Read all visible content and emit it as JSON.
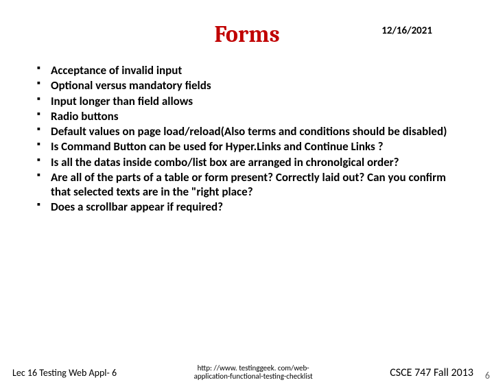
{
  "header": {
    "date": "12/16/2021"
  },
  "title": "Forms",
  "bullets": [
    "Acceptance of invalid input",
    "Optional versus mandatory fields",
    "Input longer than field allows",
    "Radio buttons",
    "Default values on page load/reload(Also terms and conditions should be disabled)",
    "Is Command Button can be used for Hyper.Links and Continue Links ?",
    "Is all the datas inside combo/list box are arranged in chronolgical order?",
    "Are all of the parts of a table or form present? Correctly laid out? Can you confirm that selected texts are in the \"right place?",
    "Does a scrollbar appear if required?"
  ],
  "footer": {
    "left": "Lec 16 Testing Web Appl- 6",
    "center_line1": "http: //www. testinggeek. com/web-",
    "center_line2": "application-functional-testing-checklist",
    "right": "CSCE 747 Fall 2013",
    "page": "6"
  }
}
